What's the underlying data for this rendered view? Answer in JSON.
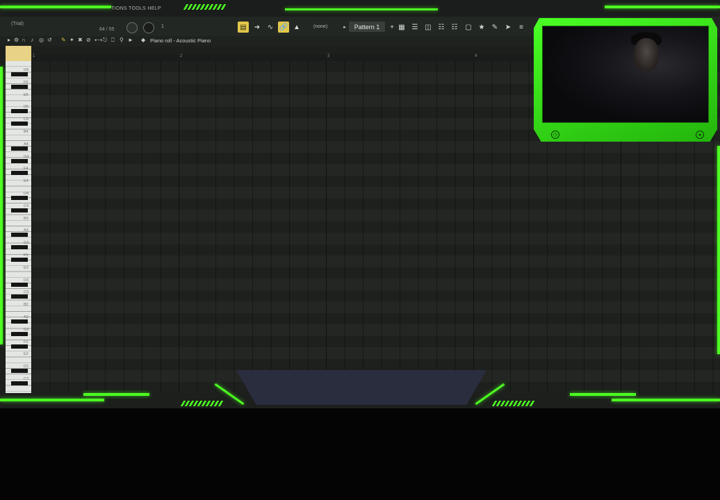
{
  "app": {
    "menu": "TIONS TOOLS HELP",
    "trial": "(Trial)",
    "position": "64 / 55",
    "snap_value": "1",
    "none_label": "(none)",
    "pattern": "Pattern 1"
  },
  "piano_roll": {
    "title": "Piano roll - Acoustic Piano",
    "ruler": [
      "1",
      "2",
      "3",
      "4"
    ],
    "note_labels": [
      "G5",
      "F5",
      "E5",
      "D5",
      "C5",
      "B4",
      "A4",
      "G4",
      "F4",
      "E4",
      "D4",
      "C4",
      "B3",
      "A3",
      "G3",
      "F3",
      "E3",
      "D3",
      "C3",
      "B2",
      "A2",
      "G2",
      "F2",
      "E2",
      "D2",
      "C2"
    ]
  },
  "colors": {
    "accent": "#4dff22",
    "highlight": "#e3c74a",
    "grid": "#1d201d"
  }
}
